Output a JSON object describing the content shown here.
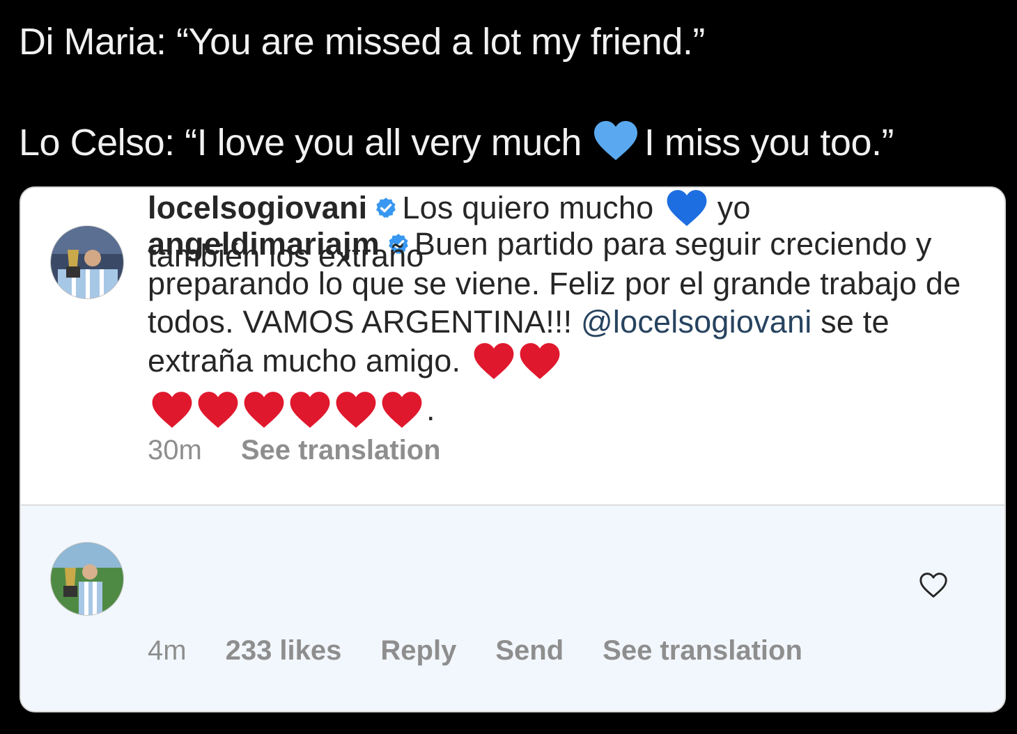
{
  "tweet": {
    "line1": "Di Maria: “You are missed a lot my friend.”",
    "line2_before": "Lo Celso: “I love you all very much",
    "line2_after": "I miss you too.”",
    "heart_icon": "blue-heart-emoji"
  },
  "comments": [
    {
      "username": "angeldimariajm",
      "verified": true,
      "text_before_mention": "Buen partido para seguir creciendo y preparando lo que se viene. Feliz por el grande trabajo de todos. VAMOS ARGENTINA!!!",
      "mention": "@locelsogiovani",
      "text_after_mention": "se te extraña mucho amigo.",
      "hearts": 8,
      "heart_icon": "red-heart-emoji",
      "trailing": ".",
      "time": "30m",
      "see_translation": "See translation"
    },
    {
      "username": "locelsogiovani",
      "verified": true,
      "text_before_heart": "Los quiero mucho",
      "heart_icon": "blue-heart-emoji",
      "text_after_heart": "yo también los extraño",
      "time": "4m",
      "likes": "233 likes",
      "reply": "Reply",
      "send": "Send",
      "see_translation": "See translation",
      "like_icon": "heart-outline-icon"
    }
  ],
  "colors": {
    "background": "#000000",
    "card": "#ffffff",
    "reply_highlight": "#f2f7fd",
    "verified_badge": "#3897f0",
    "mention": "#27435f",
    "meta": "#8e8e8e",
    "blue_heart": "#5aa9f0",
    "red_heart": "#e0182d"
  }
}
